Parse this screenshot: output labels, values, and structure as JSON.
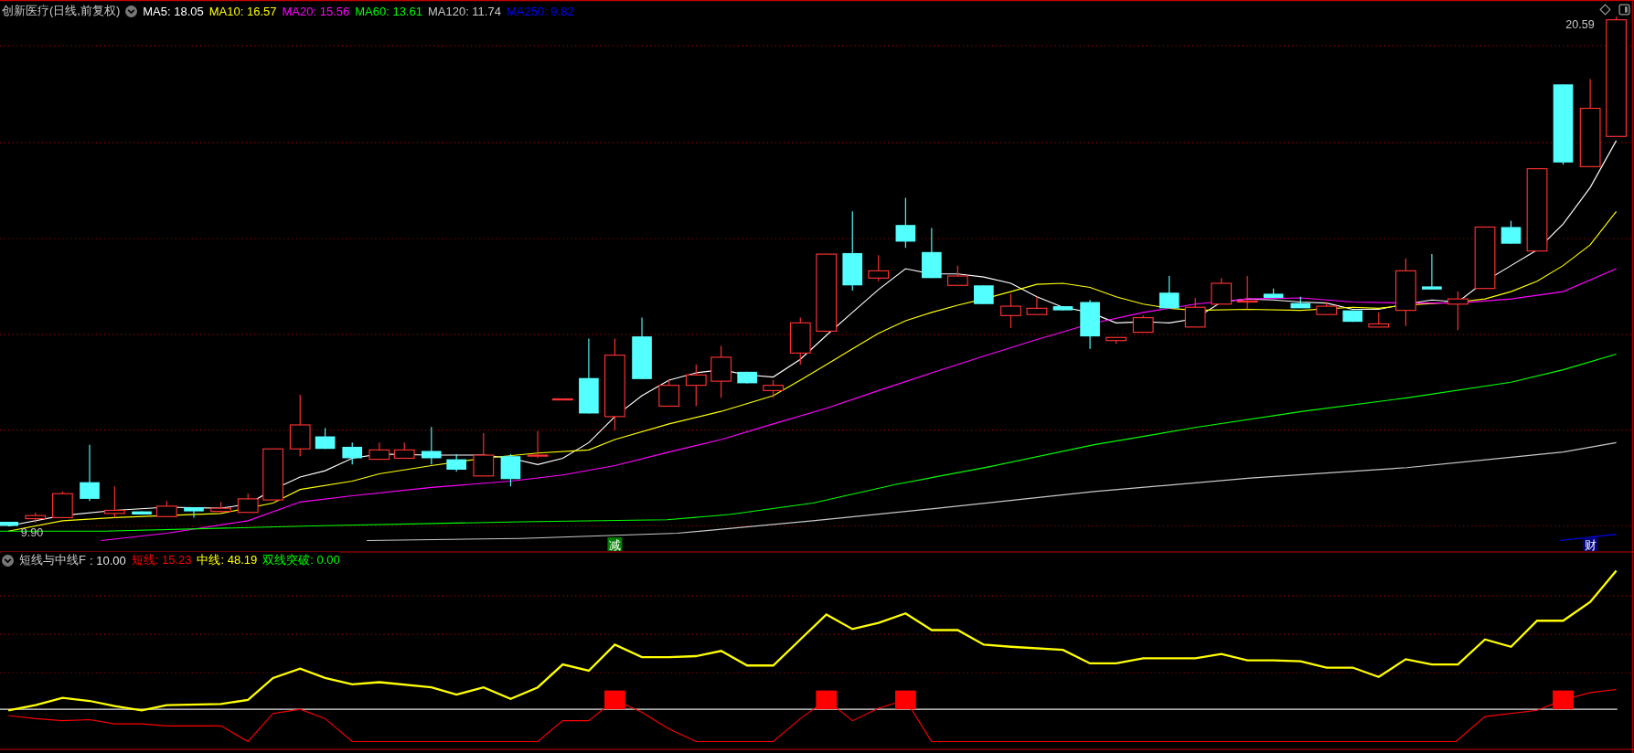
{
  "stock_header": {
    "title": "创新医疗(日线,前复权)",
    "ma_values": [
      {
        "label": "MA5: 18.05",
        "color": "#ffffff"
      },
      {
        "label": "MA10: 16.57",
        "color": "#ffff00"
      },
      {
        "label": "MA20: 15.56",
        "color": "#ff00ff"
      },
      {
        "label": "MA60: 13.61",
        "color": "#00ff00"
      },
      {
        "label": "MA120: 11.74",
        "color": "#c8c8c8"
      },
      {
        "label": "MA250: 9.82",
        "color": "#0000ff"
      }
    ]
  },
  "main_chart": {
    "high_label": "20.59",
    "low_label": "9.90",
    "markers": [
      {
        "text": "减",
        "color": "#008000"
      },
      {
        "text": "财",
        "color": "#000080"
      }
    ]
  },
  "indicator_header": {
    "title": "短线与中线F",
    "param": ": 10.00",
    "values": [
      {
        "label": "短线: 15.23",
        "color": "#ff0000"
      },
      {
        "label": "中线: 48.19",
        "color": "#ffff00"
      },
      {
        "label": "双线突破: 0.00",
        "color": "#00ff00"
      }
    ]
  }
}
